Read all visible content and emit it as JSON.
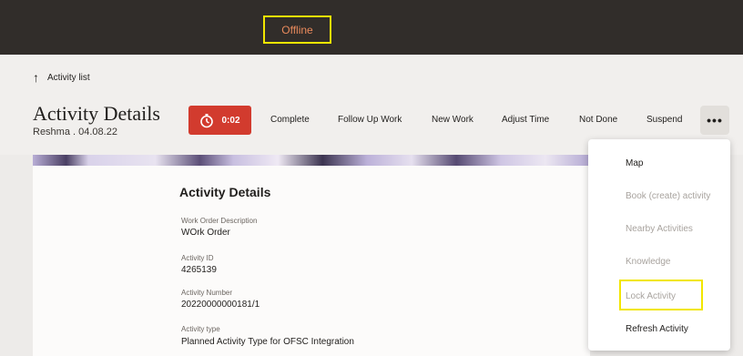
{
  "top_bar": {
    "status": "Offline",
    "status_color": "#e98a5c",
    "highlight_color": "#f2e600"
  },
  "nav": {
    "back_icon": "arrow-up-icon",
    "back_label": "Activity list"
  },
  "header": {
    "title": "Activity Details",
    "subtitle": "Reshma  . 04.08.22",
    "timer_icon": "stopwatch-icon",
    "timer": "0:02",
    "timer_color": "#d23b2e",
    "actions": [
      "Complete",
      "Follow Up Work",
      "New Work",
      "Adjust Time",
      "Not Done",
      "Suspend"
    ],
    "more_icon": "ellipsis-icon",
    "more_label": "•••"
  },
  "details": {
    "section_title": "Activity Details",
    "fields": [
      {
        "label": "Work Order Description",
        "value": "WOrk Order"
      },
      {
        "label": "Activity ID",
        "value": "4265139"
      },
      {
        "label": "Activity Number",
        "value": "20220000000181/1"
      },
      {
        "label": "Activity type",
        "value": "Planned Activity Type for OFSC Integration"
      }
    ]
  },
  "menu": {
    "items": [
      {
        "label": "Map",
        "enabled": true
      },
      {
        "label": "Book (create) activity",
        "enabled": false
      },
      {
        "label": "Nearby Activities",
        "enabled": false
      },
      {
        "label": "Knowledge",
        "enabled": false
      },
      {
        "label": "Lock Activity",
        "enabled": false,
        "highlighted": true
      },
      {
        "label": "Refresh Activity",
        "enabled": true
      }
    ]
  }
}
